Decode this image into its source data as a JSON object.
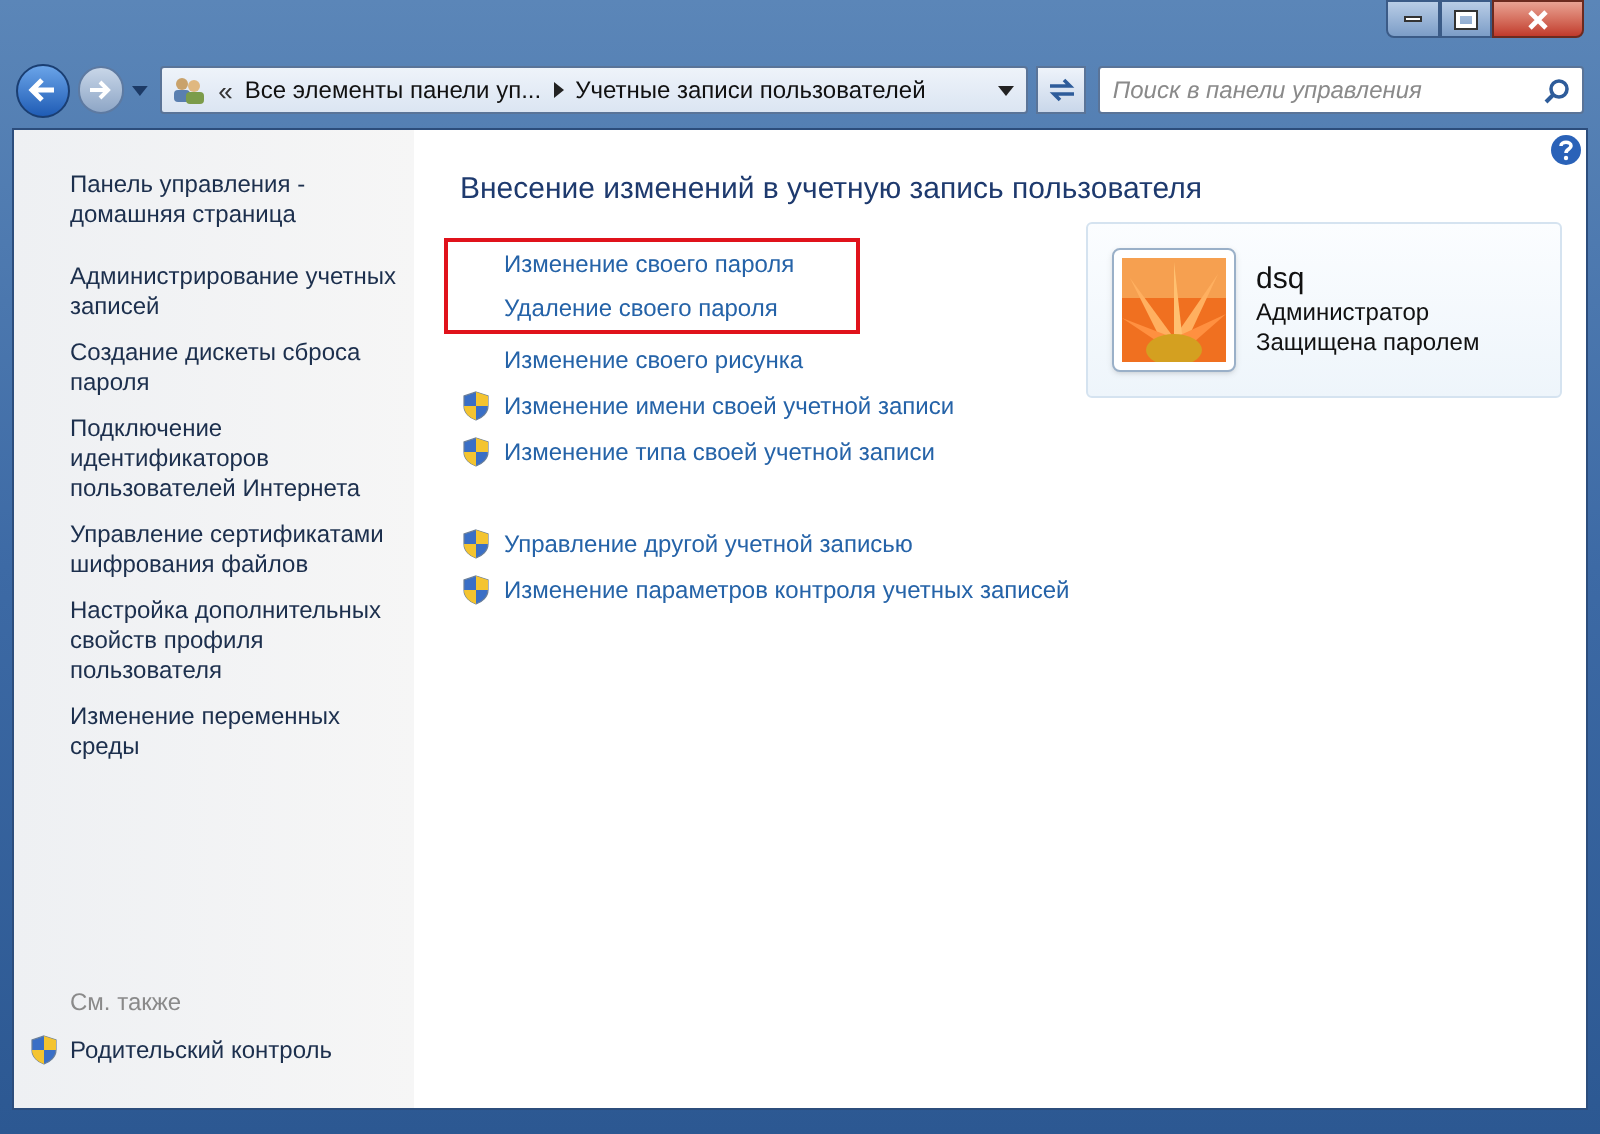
{
  "address_bar": {
    "overflow": "«",
    "crumbs": [
      "Все элементы панели уп...",
      "Учетные записи пользователей"
    ]
  },
  "search": {
    "placeholder": "Поиск в панели управления"
  },
  "sidebar": {
    "items": [
      {
        "label": "Панель управления - домашняя страница"
      },
      {
        "label": "Администрирование учетных записей"
      },
      {
        "label": "Создание дискеты сброса пароля"
      },
      {
        "label": "Подключение идентификаторов пользователей Интернета"
      },
      {
        "label": "Управление сертификатами шифрования файлов"
      },
      {
        "label": "Настройка дополнительных свойств профиля пользователя"
      },
      {
        "label": "Изменение переменных среды"
      }
    ],
    "see_also": {
      "title": "См. также",
      "items": [
        {
          "label": "Родительский контроль",
          "shield": true
        }
      ]
    }
  },
  "heading": "Внесение изменений в учетную запись пользователя",
  "task_groups": [
    {
      "highlighted": true,
      "separated": false,
      "items": [
        {
          "label": "Изменение своего пароля",
          "shield": false
        },
        {
          "label": "Удаление своего пароля",
          "shield": false
        }
      ]
    },
    {
      "highlighted": false,
      "separated": false,
      "items": [
        {
          "label": "Изменение своего рисунка",
          "shield": false
        },
        {
          "label": "Изменение имени своей учетной записи",
          "shield": true
        },
        {
          "label": "Изменение типа своей учетной записи",
          "shield": true
        }
      ]
    },
    {
      "highlighted": false,
      "separated": true,
      "items": [
        {
          "label": "Управление другой учетной записью",
          "shield": true
        },
        {
          "label": "Изменение параметров контроля учетных записей",
          "shield": true
        }
      ]
    }
  ],
  "account": {
    "name": "dsq",
    "role": "Администратор",
    "status": "Защищена паролем"
  }
}
